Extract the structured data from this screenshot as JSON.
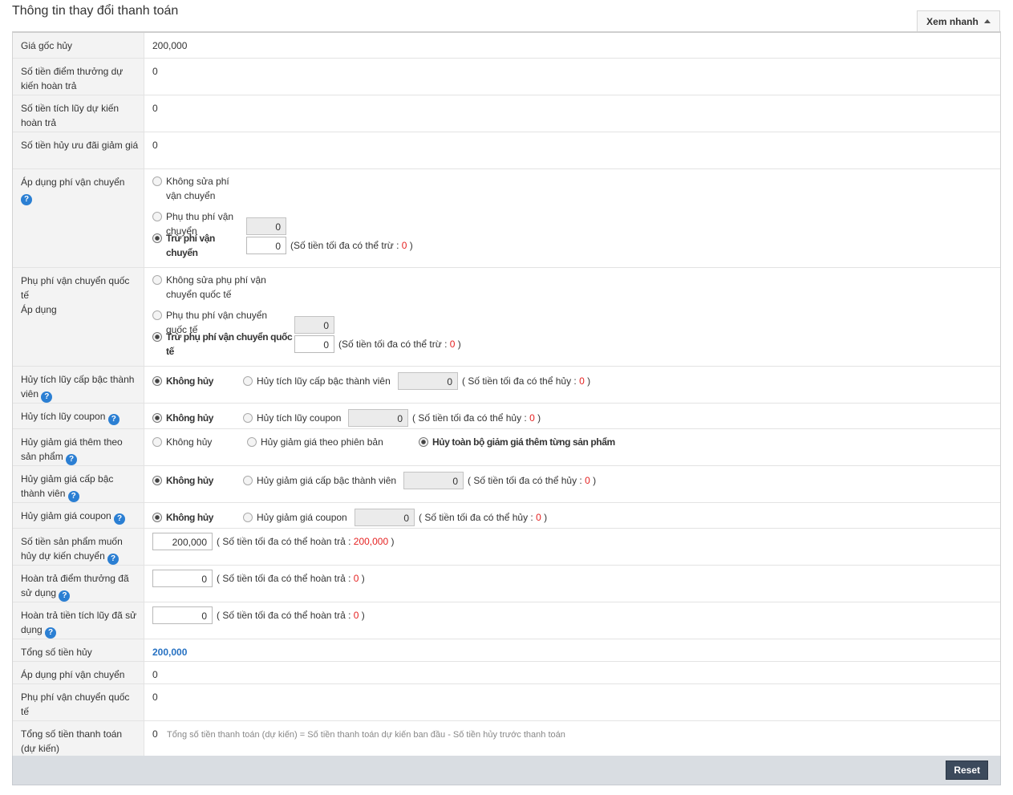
{
  "title": "Thông tin thay đổi thanh toán",
  "quick_view": "Xem nhanh",
  "help": "?",
  "rows": {
    "orig_price": {
      "label": "Giá gốc hủy",
      "value": "200,000"
    },
    "points": {
      "label": "Số tiền điểm thưởng dự kiến hoàn trả",
      "value": "0"
    },
    "accum": {
      "label": "Số tiền tích lũy dự kiến hoàn trả",
      "value": "0"
    },
    "discount": {
      "label": "Số tiền hủy ưu đãi giảm giá",
      "value": "0"
    },
    "ship": {
      "label": "Áp dụng phí vận chuyển",
      "opt1": "Không sửa phí vận chuyển",
      "opt2": "Phụ thu phí vận chuyển",
      "opt2_value": "0",
      "opt3": "Trừ phí vận chuyển",
      "opt3_value": "0",
      "note_pre": "(Số tiền tối đa có thể trừ : ",
      "note_val": "0",
      "note_post": " )"
    },
    "intl": {
      "label1": "Phụ phí vận chuyển quốc tế",
      "label2": "Áp dụng",
      "opt1": "Không sửa phụ phí vận chuyển quốc tế",
      "opt2": "Phụ thu phí vận chuyển quốc tế",
      "opt2_value": "0",
      "opt3": "Trừ phụ phí vận chuyển quốc tế",
      "opt3_value": "0",
      "note_pre": "(Số tiền tối đa có thể trừ : ",
      "note_val": "0",
      "note_post": " )"
    },
    "tier_accum": {
      "label": "Hủy tích lũy cấp bậc thành viên",
      "opt1": "Không hủy",
      "opt2": "Hủy tích lũy cấp bậc thành viên",
      "value": "0",
      "note_pre": "( Số tiền tối đa có thể hủy : ",
      "note_val": "0",
      "note_post": " )"
    },
    "coupon_accum": {
      "label": "Hủy tích lũy coupon",
      "opt1": "Không hủy",
      "opt2": "Hủy tích lũy coupon",
      "value": "0",
      "note_pre": "( Số tiền tối đa có thể hủy : ",
      "note_val": "0",
      "note_post": " )"
    },
    "product_disc": {
      "label": "Hủy giảm giá thêm theo sản phẩm",
      "opt1": "Không hủy",
      "opt2": "Hủy giảm giá theo phiên bản",
      "opt3": "Hủy toàn bộ giảm giá thêm từng sản phẩm"
    },
    "tier_disc": {
      "label": "Hủy giảm giá cấp bậc thành viên",
      "opt1": "Không hủy",
      "opt2": "Hủy giảm giá cấp bậc thành viên",
      "value": "0",
      "note_pre": "( Số tiền tối đa có thể hủy : ",
      "note_val": "0",
      "note_post": " )"
    },
    "coupon_disc": {
      "label": "Hủy giảm giá coupon",
      "opt1": "Không hủy",
      "opt2": "Hủy giảm giá coupon",
      "value": "0",
      "note_pre": "( Số tiền tối đa có thể hủy : ",
      "note_val": "0",
      "note_post": " )"
    },
    "product_amount": {
      "label": "Số tiền sản phẩm muốn hủy dự kiến chuyển",
      "value": "200,000",
      "note_pre": "( Số tiền tối đa có thể hoàn trả : ",
      "note_val": "200,000",
      "note_post": " )"
    },
    "points_used": {
      "label": "Hoàn trả điểm thưởng đã sử dụng",
      "value": "0",
      "note_pre": "( Số tiền tối đa có thể hoàn trả : ",
      "note_val": "0",
      "note_post": " )"
    },
    "accum_used": {
      "label": "Hoàn trả tiền tích lũy đã sử dụng",
      "value": "0",
      "note_pre": "( Số tiền tối đa có thể hoàn trả : ",
      "note_val": "0",
      "note_post": " )"
    },
    "total_cancel": {
      "label": "Tổng số tiền hủy",
      "value": "200,000"
    },
    "ship_applied": {
      "label": "Áp dụng phí vận chuyển",
      "value": "0"
    },
    "intl_fee": {
      "label": "Phụ phí vận chuyển quốc tế",
      "value": "0"
    },
    "total_pay": {
      "label": "Tổng số tiền thanh toán (dự kiến)",
      "value": "0",
      "formula": "Tổng số tiền thanh toán (dự kiến) = Số tiền thanh toán dự kiến ban đầu - Số tiền hủy trước thanh toán"
    }
  },
  "reset": "Reset",
  "colors": {
    "accent": "#2b7fd3",
    "note_value": "#e52222",
    "total": "#2671c2",
    "reset_bg": "#3c4a5c"
  }
}
